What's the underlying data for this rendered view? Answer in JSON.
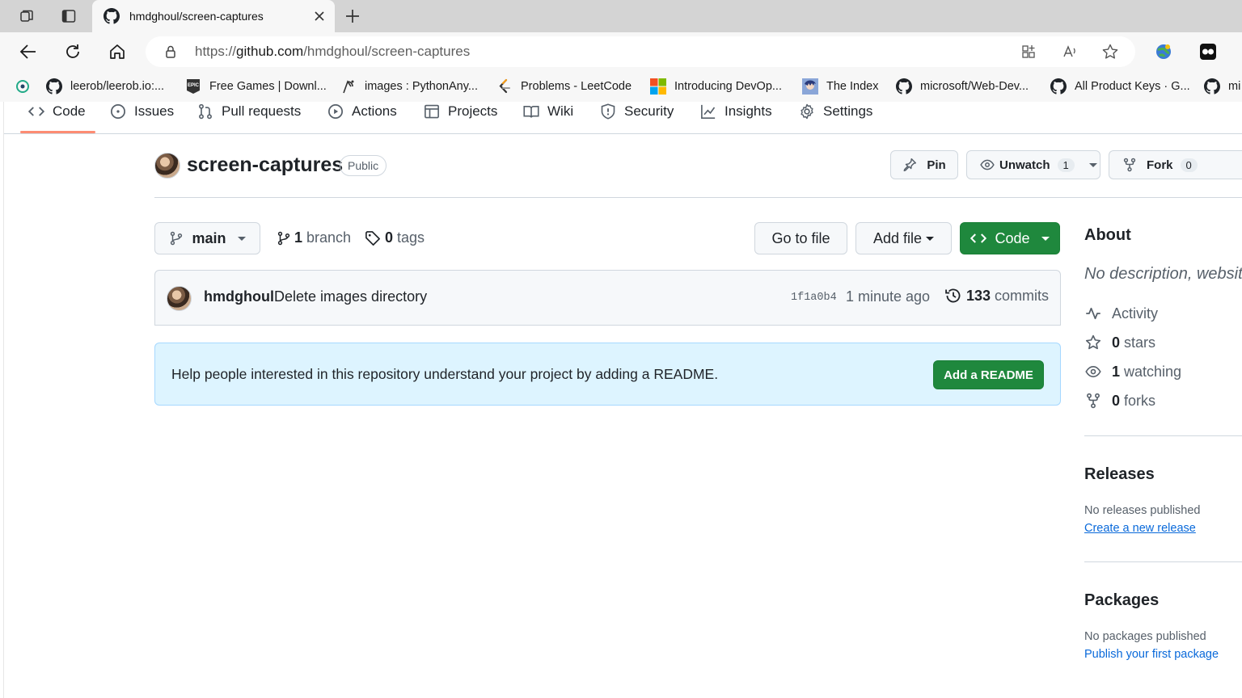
{
  "browser": {
    "tab_title": "hmdghoul/screen-captures",
    "url_prefix": "https://",
    "url_domain": "github.com",
    "url_path": "/hmdghoul/screen-captures",
    "bookmarks": [
      {
        "label": "leerob/leerob.io:...",
        "icon": "github-icon"
      },
      {
        "label": "Free Games | Downl...",
        "icon": "epic-games-icon"
      },
      {
        "label": "images : PythonAny...",
        "icon": "python-icon"
      },
      {
        "label": "Problems - LeetCode",
        "icon": "leetcode-icon"
      },
      {
        "label": "Introducing DevOp...",
        "icon": "microsoft-icon"
      },
      {
        "label": "The Index",
        "icon": "anime-icon"
      },
      {
        "label": "microsoft/Web-Dev...",
        "icon": "github-icon"
      },
      {
        "label": "All Product Keys · G...",
        "icon": "github-icon"
      },
      {
        "label": "mi",
        "icon": "github-icon"
      }
    ]
  },
  "reponav": {
    "code": "Code",
    "issues": "Issues",
    "pulls": "Pull requests",
    "actions": "Actions",
    "projects": "Projects",
    "wiki": "Wiki",
    "security": "Security",
    "insights": "Insights",
    "settings": "Settings"
  },
  "repo": {
    "name": "screen-captures",
    "visibility": "Public",
    "pin": "Pin",
    "unwatch": "Unwatch",
    "watch_count": "1",
    "fork": "Fork",
    "fork_count": "0"
  },
  "filebar": {
    "branch": "main",
    "branch_count": "1",
    "branch_label": "branch",
    "tag_count": "0",
    "tag_label": "tags",
    "go_to_file": "Go to file",
    "add_file": "Add file",
    "code": "Code"
  },
  "commit": {
    "author": "hmdghoul",
    "message": "Delete images directory",
    "sha": "1f1a0b4",
    "time": "1 minute ago",
    "count": "133",
    "count_label": "commits"
  },
  "readme": {
    "text": "Help people interested in this repository understand your project by adding a README.",
    "button": "Add a README"
  },
  "sidebar": {
    "about_title": "About",
    "description": "No description, website",
    "activity": "Activity",
    "stars_count": "0",
    "stars_label": "stars",
    "watching_count": "1",
    "watching_label": "watching",
    "forks_count": "0",
    "forks_label": "forks",
    "releases_title": "Releases",
    "releases_none": "No releases published",
    "releases_link": "Create a new release",
    "packages_title": "Packages",
    "packages_none": "No packages published",
    "packages_link": "Publish your first package"
  },
  "colors": {
    "primary_green": "#1f883d",
    "link_blue": "#0969da",
    "tab_underline": "#fd8c73",
    "readme_bg": "#ddf4ff"
  }
}
